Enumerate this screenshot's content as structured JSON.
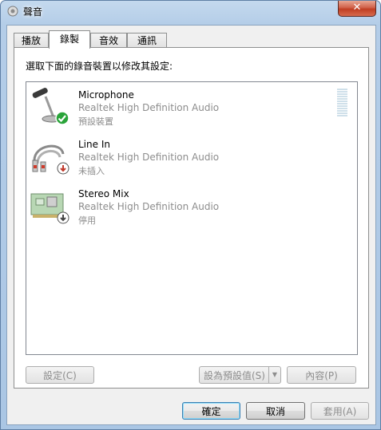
{
  "window": {
    "title": "聲音",
    "close_glyph": "✕"
  },
  "tabs": [
    {
      "label": "播放",
      "active": false
    },
    {
      "label": "錄製",
      "active": true
    },
    {
      "label": "音效",
      "active": false
    },
    {
      "label": "通訊",
      "active": false
    }
  ],
  "instruction": "選取下面的錄音裝置以修改其設定:",
  "devices": [
    {
      "name": "Microphone",
      "driver": "Realtek High Definition Audio",
      "status": "預設裝置",
      "icon": "microphone-icon",
      "badge": "default-checkmark-icon"
    },
    {
      "name": "Line In",
      "driver": "Realtek High Definition Audio",
      "status": "未插入",
      "icon": "line-in-cable-icon",
      "badge": "unplugged-icon"
    },
    {
      "name": "Stereo Mix",
      "driver": "Realtek High Definition Audio",
      "status": "停用",
      "icon": "sound-card-icon",
      "badge": "disabled-icon"
    }
  ],
  "level_meter": {
    "level": 0
  },
  "panel_buttons": {
    "configure": "設定(C)",
    "set_default": "設為預設值(S)",
    "properties": "內容(P)"
  },
  "dialog_buttons": {
    "ok": "確定",
    "cancel": "取消",
    "apply": "套用(A)"
  },
  "colors": {
    "titlebar": "#b4cde8",
    "close": "#c03e23",
    "check_badge": "#2aa43a",
    "disabled_text": "#8d8d8d"
  }
}
